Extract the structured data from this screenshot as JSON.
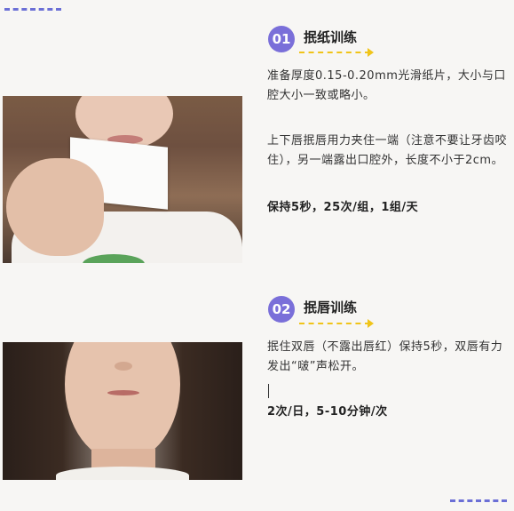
{
  "section1": {
    "number": "01",
    "title": "抿纸训练",
    "desc1": "准备厚度0.15-0.20mm光滑纸片，大小与口腔大小一致或略小。",
    "desc2": "上下唇抿唇用力夹住一端（注意不要让牙齿咬住），另一端露出口腔外，长度不小于2cm。",
    "frequency": "保持5秒，25次/组，1组/天"
  },
  "section2": {
    "number": "02",
    "title": "抿唇训练",
    "desc1": "抿住双唇（不露出唇红）保持5秒，双唇有力发出“啵”声松开。",
    "frequency": "2次/日，5-10分钟/次"
  },
  "colors": {
    "accent": "#7a6fd9",
    "arrow": "#f0c419",
    "background": "#f7f6f4"
  }
}
